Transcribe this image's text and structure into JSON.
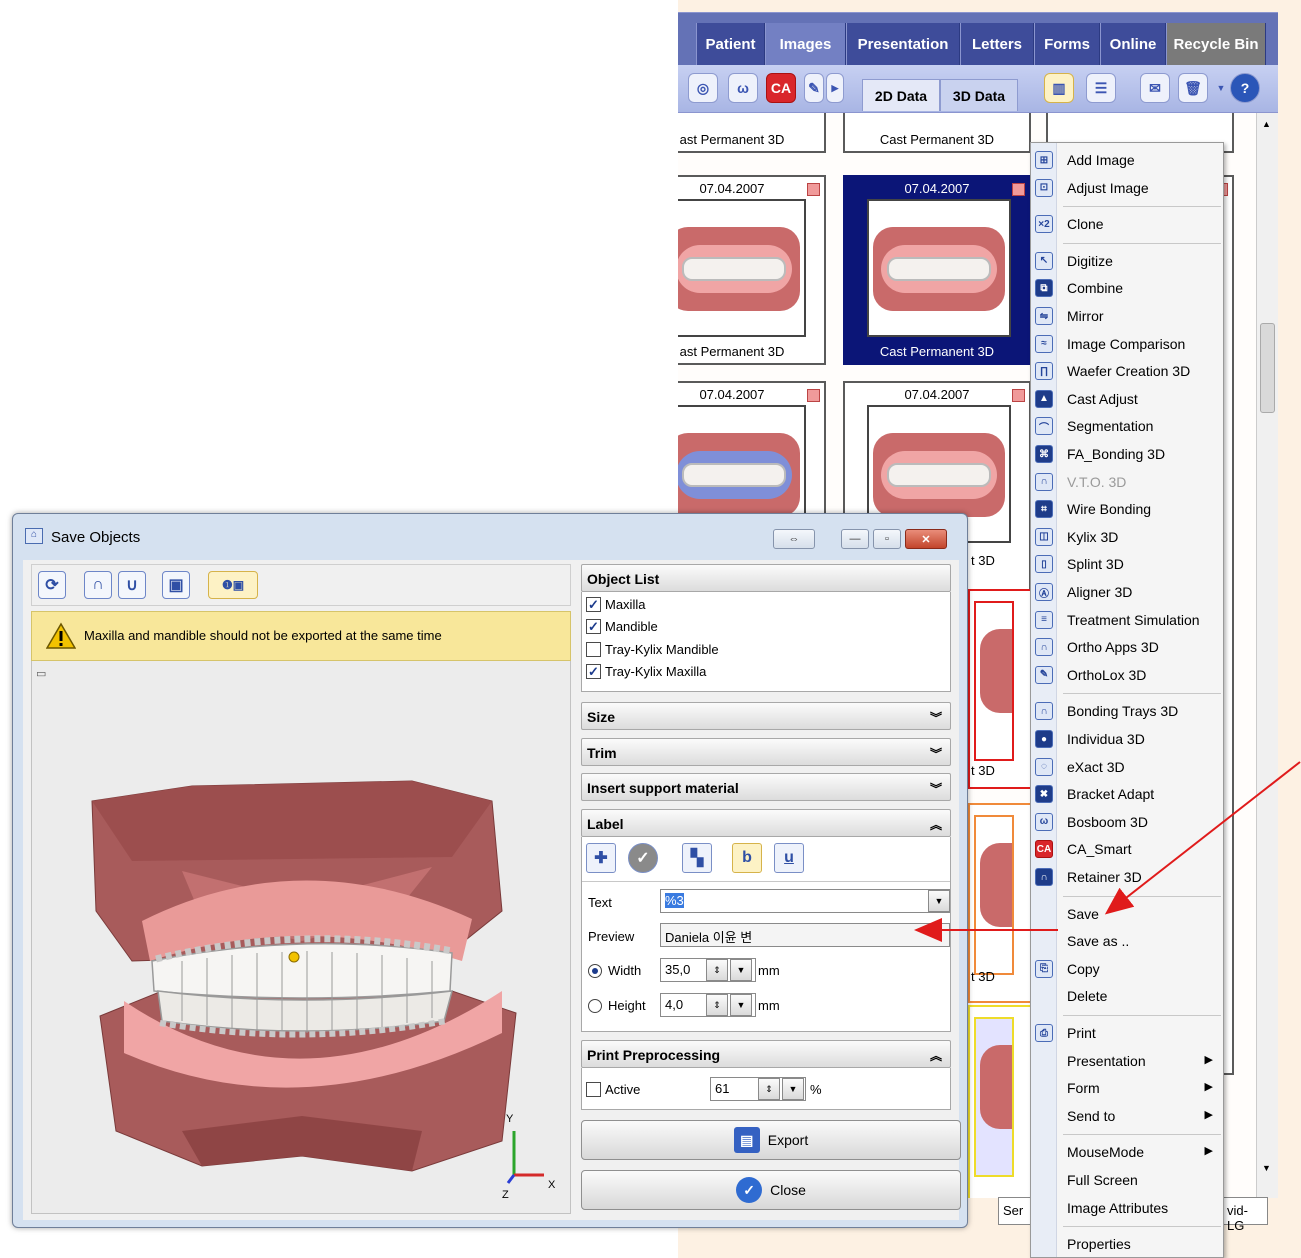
{
  "app": {
    "tabs": [
      "Patient",
      "Images",
      "Presentation",
      "Letters",
      "Forms",
      "Online",
      "Recycle Bin"
    ],
    "active_tab": "Images",
    "data_tabs": [
      "2D Data",
      "3D Data"
    ],
    "active_data_tab": "3D Data",
    "cards": [
      {
        "date": "",
        "label": "ast Permanent 3D"
      },
      {
        "date": "",
        "label": "Cast Permanent 3D"
      },
      {
        "date": "07.04.2007",
        "label": "ast Permanent 3D"
      },
      {
        "date": "07.04.2007",
        "label": "Cast Permanent 3D"
      },
      {
        "date": "07.04.2007",
        "label": ""
      },
      {
        "date": "07.04.2007",
        "label": ""
      }
    ],
    "partial_labels": [
      "t 3D",
      "t 3D",
      "t 3D",
      "t 3D"
    ],
    "status_fields": [
      "Ser",
      "vid-LG"
    ]
  },
  "context_menu": {
    "items": [
      {
        "label": "Add Image",
        "icon": "add-image-icon"
      },
      {
        "label": "Adjust Image",
        "icon": "adjust-image-icon"
      },
      {
        "label": "Clone",
        "icon": "clone-icon"
      },
      {
        "label": "Digitize",
        "icon": "digitize-icon"
      },
      {
        "label": "Combine",
        "icon": "combine-icon"
      },
      {
        "label": "Mirror",
        "icon": "mirror-icon"
      },
      {
        "label": "Image Comparison",
        "icon": "image-comparison-icon"
      },
      {
        "label": "Waefer Creation 3D",
        "icon": "waefer-icon"
      },
      {
        "label": "Cast Adjust",
        "icon": "cast-adjust-icon"
      },
      {
        "label": "Segmentation",
        "icon": "segmentation-icon"
      },
      {
        "label": "FA_Bonding 3D",
        "icon": "fa-bonding-icon"
      },
      {
        "label": "V.T.O. 3D",
        "icon": "vto-icon",
        "disabled": true
      },
      {
        "label": "Wire Bonding",
        "icon": "wire-bonding-icon"
      },
      {
        "label": "Kylix 3D",
        "icon": "kylix-icon"
      },
      {
        "label": "Splint 3D",
        "icon": "splint-icon"
      },
      {
        "label": "Aligner 3D",
        "icon": "aligner-icon"
      },
      {
        "label": "Treatment Simulation",
        "icon": "treatment-simulation-icon"
      },
      {
        "label": "Ortho Apps 3D",
        "icon": "ortho-apps-icon"
      },
      {
        "label": "OrthoLox 3D",
        "icon": "ortholox-icon"
      },
      {
        "label": "Bonding Trays 3D",
        "icon": "bonding-trays-icon"
      },
      {
        "label": "Individua 3D",
        "icon": "individua-icon"
      },
      {
        "label": "eXact 3D",
        "icon": "exact-icon"
      },
      {
        "label": "Bracket Adapt",
        "icon": "bracket-adapt-icon"
      },
      {
        "label": "Bosboom 3D",
        "icon": "bosboom-icon"
      },
      {
        "label": "CA_Smart",
        "icon": "ca-smart-icon"
      },
      {
        "label": "Retainer 3D",
        "icon": "retainer-icon"
      },
      {
        "label": "Save",
        "icon": ""
      },
      {
        "label": "Save as ..",
        "icon": ""
      },
      {
        "label": "Copy",
        "icon": "copy-icon"
      },
      {
        "label": "Delete",
        "icon": ""
      },
      {
        "label": "Print",
        "icon": "print-icon"
      },
      {
        "label": "Presentation",
        "icon": "",
        "submenu": true
      },
      {
        "label": "Form",
        "icon": "",
        "submenu": true
      },
      {
        "label": "Send to",
        "icon": "",
        "submenu": true
      },
      {
        "label": "MouseMode",
        "icon": "",
        "submenu": true
      },
      {
        "label": "Full Screen",
        "icon": ""
      },
      {
        "label": "Image Attributes",
        "icon": ""
      },
      {
        "label": "Properties",
        "icon": ""
      }
    ]
  },
  "dialog": {
    "title": "Save Objects",
    "warning": "Maxilla and mandible should not be exported at the same time",
    "object_list": {
      "header": "Object List",
      "items": [
        {
          "label": "Maxilla",
          "checked": true
        },
        {
          "label": "Mandible",
          "checked": true
        },
        {
          "label": "Tray-Kylix Mandible",
          "checked": false
        },
        {
          "label": "Tray-Kylix Maxilla",
          "checked": true
        }
      ]
    },
    "sections": {
      "size": "Size",
      "trim": "Trim",
      "support": "Insert support material",
      "label": "Label",
      "print": "Print Preprocessing"
    },
    "label_form": {
      "text_label": "Text",
      "text_value": "%3",
      "preview_label": "Preview",
      "preview_value": "Daniela 이윤 변",
      "width_label": "Width",
      "width_value": "35,0",
      "height_label": "Height",
      "height_value": "4,0",
      "unit": "mm",
      "width_selected": true
    },
    "print_form": {
      "active_label": "Active",
      "active_checked": false,
      "value": "61",
      "unit": "%"
    },
    "buttons": {
      "export": "Export",
      "close": "Close"
    },
    "axes": {
      "y": "Y",
      "x": "X",
      "z": "Z"
    }
  }
}
